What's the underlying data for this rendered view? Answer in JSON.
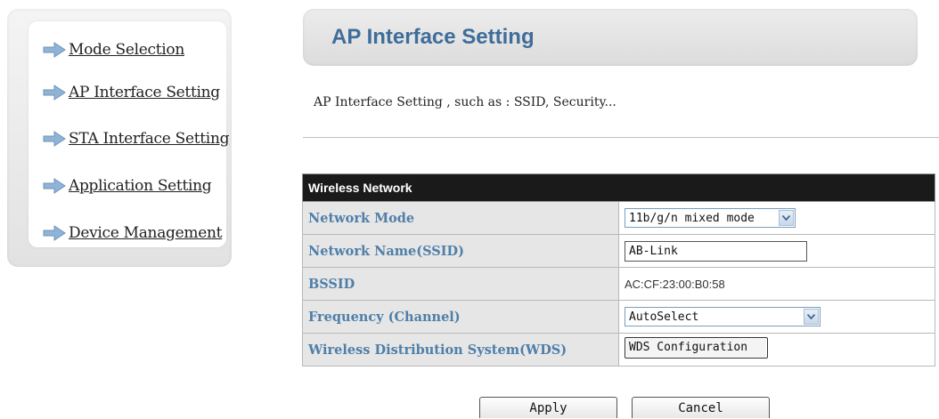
{
  "sidebar": {
    "items": [
      {
        "label": "Mode Selection",
        "icon": "arrow-right-icon"
      },
      {
        "label": "AP Interface Setting",
        "icon": "arrow-right-icon"
      },
      {
        "label": "STA Interface Setting",
        "icon": "arrow-right-icon"
      },
      {
        "label": "Application Setting",
        "icon": "arrow-right-icon"
      },
      {
        "label": "Device Management",
        "icon": "arrow-right-icon"
      }
    ]
  },
  "header": {
    "title": "AP Interface Setting"
  },
  "description": "AP Interface Setting , such as : SSID, Security...",
  "table": {
    "heading": "Wireless Network",
    "rows": {
      "network_mode": {
        "label": "Network Mode",
        "value": "11b/g/n mixed mode"
      },
      "ssid": {
        "label": "Network Name(SSID)",
        "value": "AB-Link"
      },
      "bssid": {
        "label": "BSSID",
        "value": "AC:CF:23:00:B0:58"
      },
      "frequency": {
        "label": "Frequency (Channel)",
        "value": "AutoSelect"
      },
      "wds": {
        "label": "Wireless Distribution System(WDS)",
        "button": "WDS Configuration"
      }
    }
  },
  "buttons": {
    "apply": "Apply",
    "cancel": "Cancel"
  },
  "colors": {
    "accent": "#3f6d9a",
    "label_text": "#4f7fa8",
    "table_header": "#1a1a1a",
    "arrow": "#8fb4d8"
  }
}
